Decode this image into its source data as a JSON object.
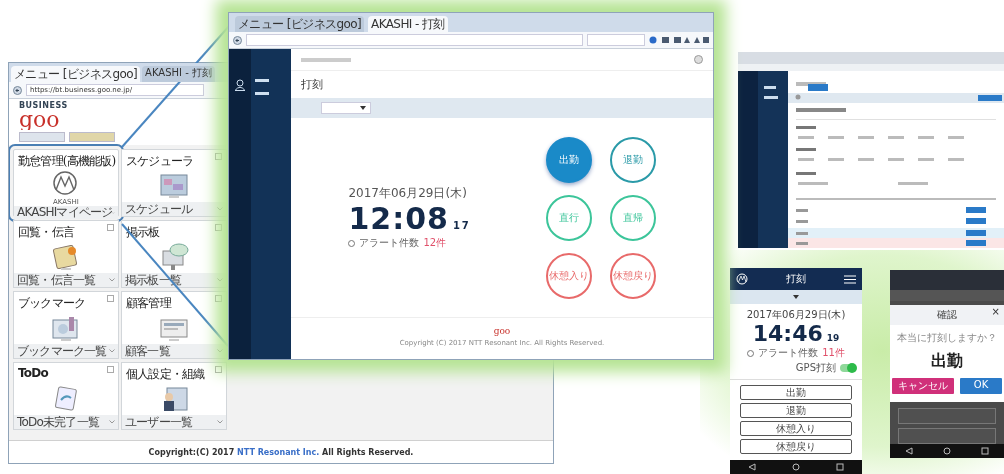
{
  "menu_browser": {
    "tabs": [
      {
        "label": "メニュー [ビジネスgoo]",
        "selected": true
      },
      {
        "label": "AKASHI - 打刻",
        "selected": false
      }
    ],
    "address": "https://bt.business.goo.ne.jp/",
    "logo": {
      "tagline": "BUSINESS",
      "wordmark": "goo"
    },
    "tiles": [
      {
        "title": "勤怠管理(高機能版)",
        "logo_text": "AKASHI",
        "link": "AKASHIマイページ",
        "highlighted": true
      },
      {
        "title": "スケジューラ",
        "link": "スケジュール",
        "highlighted": false
      },
      {
        "title": "回覧・伝言",
        "link": "回覧・伝言一覧",
        "highlighted": false
      },
      {
        "title": "掲示板",
        "link": "掲示板一覧",
        "highlighted": false
      },
      {
        "title": "ブックマーク",
        "link": "ブックマーク一覧",
        "highlighted": false
      },
      {
        "title": "顧客管理",
        "link": "顧客一覧",
        "highlighted": false
      },
      {
        "title": "ToDo",
        "link": "ToDo未完了一覧",
        "highlighted": false
      },
      {
        "title": "個人設定・組織",
        "link": "ユーザー一覧",
        "highlighted": false
      }
    ],
    "footer": {
      "before": "Copyright:(C) 2017 ",
      "link": "NTT Resonant Inc.",
      "after": " All Rights Reserved."
    }
  },
  "akashi_browser": {
    "tabs": [
      {
        "label": "メニュー [ビジネスgoo]",
        "selected": false
      },
      {
        "label": "AKASHI - 打刻",
        "selected": true
      }
    ],
    "page_title": "打刻",
    "date": "2017年06月29日(木)",
    "time": "12:08",
    "seconds": "17",
    "alert_label": "アラート件数",
    "alert_count": "12件",
    "punch_buttons": [
      {
        "label": "出勤",
        "color": "#1a8ac8",
        "selected": true
      },
      {
        "label": "退勤",
        "color": "#2a9aa8",
        "selected": false
      },
      {
        "label": "直行",
        "color": "#3cc59a",
        "selected": false
      },
      {
        "label": "直帰",
        "color": "#3cc59a",
        "selected": false
      },
      {
        "label": "休憩入り",
        "color": "#e86a6a",
        "selected": false
      },
      {
        "label": "休憩戻り",
        "color": "#e86a6a",
        "selected": false
      }
    ],
    "footer_logo": "goo",
    "copyright": "Copyright (C) 2017 NTT Resonant Inc. All Rights Reserved."
  },
  "phone_punch": {
    "title": "打刻",
    "date": "2017年06月29日(木)",
    "time": "14:46",
    "seconds": "19",
    "alert_label": "アラート件数",
    "alert_count": "11件",
    "gps_label": "GPS打刻",
    "gps_on": true,
    "buttons": [
      "出勤",
      "退勤",
      "休憩入り",
      "休憩戻り"
    ]
  },
  "phone_confirm": {
    "dialog_title": "確認",
    "close": "×",
    "question": "本当に打刻しますか？",
    "action": "出勤",
    "cancel": "キャンセル",
    "ok": "OK"
  }
}
